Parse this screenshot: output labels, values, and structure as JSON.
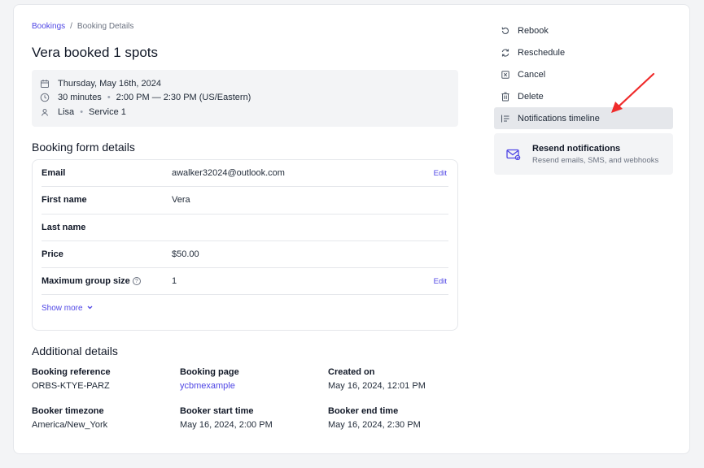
{
  "breadcrumb": {
    "parent": "Bookings",
    "separator": "/",
    "current": "Booking Details"
  },
  "page_title": "Vera booked 1 spots",
  "summary": {
    "date": "Thursday, May 16th, 2024",
    "duration": "30 minutes",
    "time": "2:00 PM — 2:30 PM (US/Eastern)",
    "staff": "Lisa",
    "service": "Service 1",
    "separator": "•"
  },
  "form_section_title": "Booking form details",
  "form_rows": [
    {
      "label": "Email",
      "value": "awalker32024@outlook.com",
      "edit": "Edit"
    },
    {
      "label": "First name",
      "value": "Vera",
      "edit": ""
    },
    {
      "label": "Last name",
      "value": "",
      "edit": ""
    },
    {
      "label": "Price",
      "value": "$50.00",
      "edit": ""
    },
    {
      "label": "Maximum group size",
      "value": "1",
      "edit": "Edit"
    }
  ],
  "help_glyph": "?",
  "show_more": "Show more",
  "additional_section_title": "Additional details",
  "details": [
    {
      "label": "Booking reference",
      "value": "ORBS-KTYE-PARZ"
    },
    {
      "label": "Booking page",
      "value": "ycbmexample"
    },
    {
      "label": "Created on",
      "value": "May 16, 2024, 12:01 PM"
    },
    {
      "label": "Booker timezone",
      "value": "America/New_York"
    },
    {
      "label": "Booker start time",
      "value": "May 16, 2024, 2:00 PM"
    },
    {
      "label": "Booker end time",
      "value": "May 16, 2024, 2:30 PM"
    }
  ],
  "actions": {
    "rebook": "Rebook",
    "reschedule": "Reschedule",
    "cancel": "Cancel",
    "delete": "Delete",
    "notifications_timeline": "Notifications timeline"
  },
  "resend": {
    "title": "Resend notifications",
    "subtitle": "Resend emails, SMS, and webhooks"
  },
  "colors": {
    "accent": "#4f46e5",
    "annotation_arrow": "#ef2b2b",
    "panel_bg": "#f3f4f6"
  }
}
